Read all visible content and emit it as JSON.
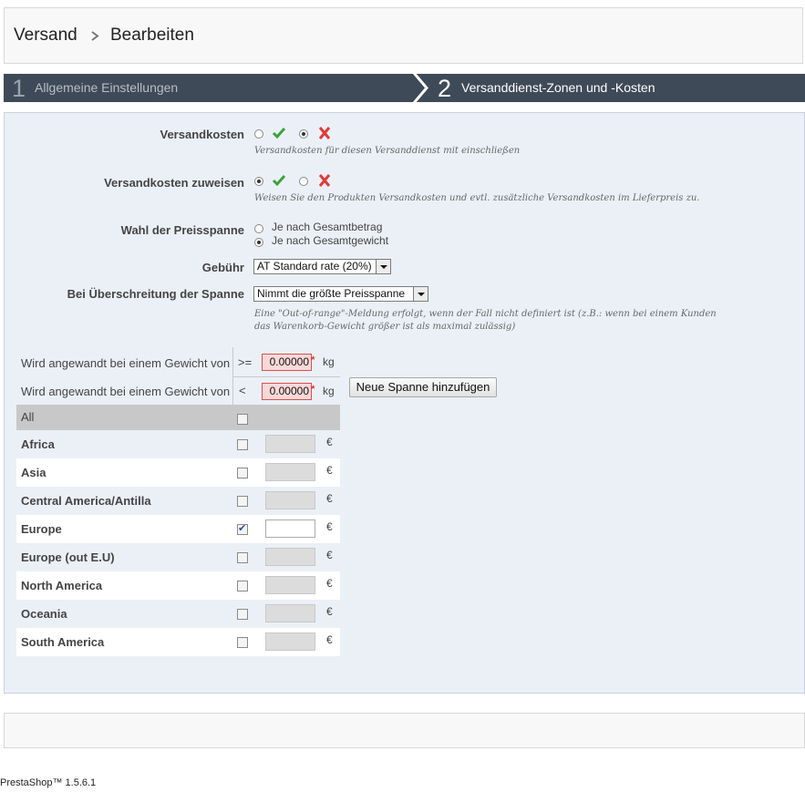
{
  "breadcrumb": {
    "section": "Versand",
    "current": "Bearbeiten"
  },
  "steps": [
    {
      "number": "1",
      "label": "Allgemeine Einstellungen"
    },
    {
      "number": "2",
      "label": "Versanddienst-Zonen und -Kosten"
    }
  ],
  "form": {
    "shipping_costs": {
      "label": "Versandkosten",
      "hint": "Versandkosten für diesen Versanddienst mit einschließen",
      "selected": "no"
    },
    "assign_costs": {
      "label": "Versandkosten zuweisen",
      "hint": "Weisen Sie den Produkten Versandkosten und evtl. zusätzliche Versandkosten im Lieferpreis zu.",
      "selected": "yes"
    },
    "range_choice": {
      "label": "Wahl der Preisspanne",
      "option1": "Je nach Gesamtbetrag",
      "option2": "Je nach Gesamtgewicht",
      "selected": "option2"
    },
    "tax": {
      "label": "Gebühr",
      "value": "AT Standard rate (20%)"
    },
    "out_of_range": {
      "label": "Bei Überschreitung der Spanne",
      "value": "Nimmt die größte Preisspanne",
      "hint_line1": "Eine \"Out-of-range\"-Meldung erfolgt, wenn der Fall nicht definiert ist (z.B.: wenn bei einem Kunden",
      "hint_line2": "das Warenkorb-Gewicht größer ist als maximal zulässig)"
    }
  },
  "ranges": {
    "row1": {
      "label": "Wird angewandt bei einem Gewicht von",
      "operator": ">=",
      "value": "0.00000",
      "unit": "kg"
    },
    "row2": {
      "label": "Wird angewandt bei einem Gewicht von",
      "operator": "<",
      "value": "0.00000",
      "unit": "kg"
    },
    "add_button": "Neue Spanne hinzufügen"
  },
  "zones": {
    "all_label": "All",
    "currency": "€",
    "items": [
      {
        "name": "Africa",
        "checked": false
      },
      {
        "name": "Asia",
        "checked": false
      },
      {
        "name": "Central America/Antilla",
        "checked": false
      },
      {
        "name": "Europe",
        "checked": true
      },
      {
        "name": "Europe (out E.U)",
        "checked": false
      },
      {
        "name": "North America",
        "checked": false
      },
      {
        "name": "Oceania",
        "checked": false
      },
      {
        "name": "South America",
        "checked": false
      }
    ]
  },
  "colors": {
    "accent_green": "#3aa33a",
    "accent_red": "#e23a3a",
    "steps_bg": "#3f4a58"
  },
  "footer": {
    "version": "PrestaShop™ 1.5.6.1"
  }
}
